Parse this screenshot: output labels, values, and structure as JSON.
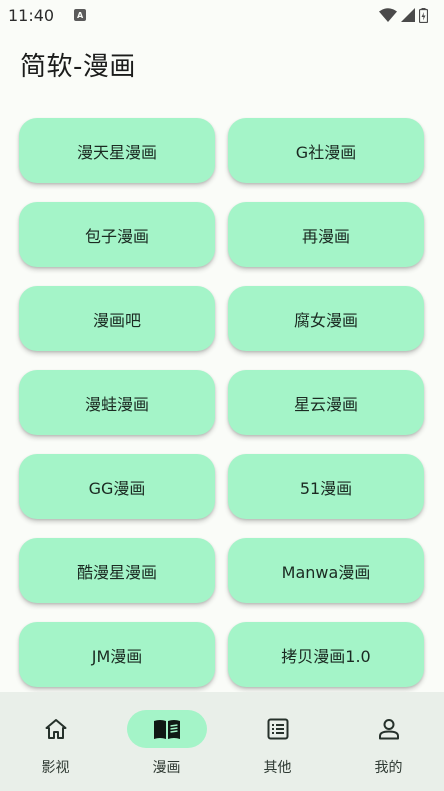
{
  "status_bar": {
    "time": "11:40",
    "badge": "A"
  },
  "page": {
    "title": "简软-漫画"
  },
  "sources": [
    "漫天星漫画",
    "G社漫画",
    "包子漫画",
    "再漫画",
    "漫画吧",
    "腐女漫画",
    "漫蛙漫画",
    "星云漫画",
    "GG漫画",
    "51漫画",
    "酷漫星漫画",
    "Manwa漫画",
    "JM漫画",
    "拷贝漫画1.0"
  ],
  "bottom_nav": [
    {
      "label": "影视",
      "icon": "home-icon"
    },
    {
      "label": "漫画",
      "icon": "book-icon",
      "active": true
    },
    {
      "label": "其他",
      "icon": "list-icon"
    },
    {
      "label": "我的",
      "icon": "person-icon"
    }
  ],
  "colors": {
    "accent": "#a4f4c8",
    "background": "#fafcf8",
    "nav_bg": "#e9efe9"
  }
}
